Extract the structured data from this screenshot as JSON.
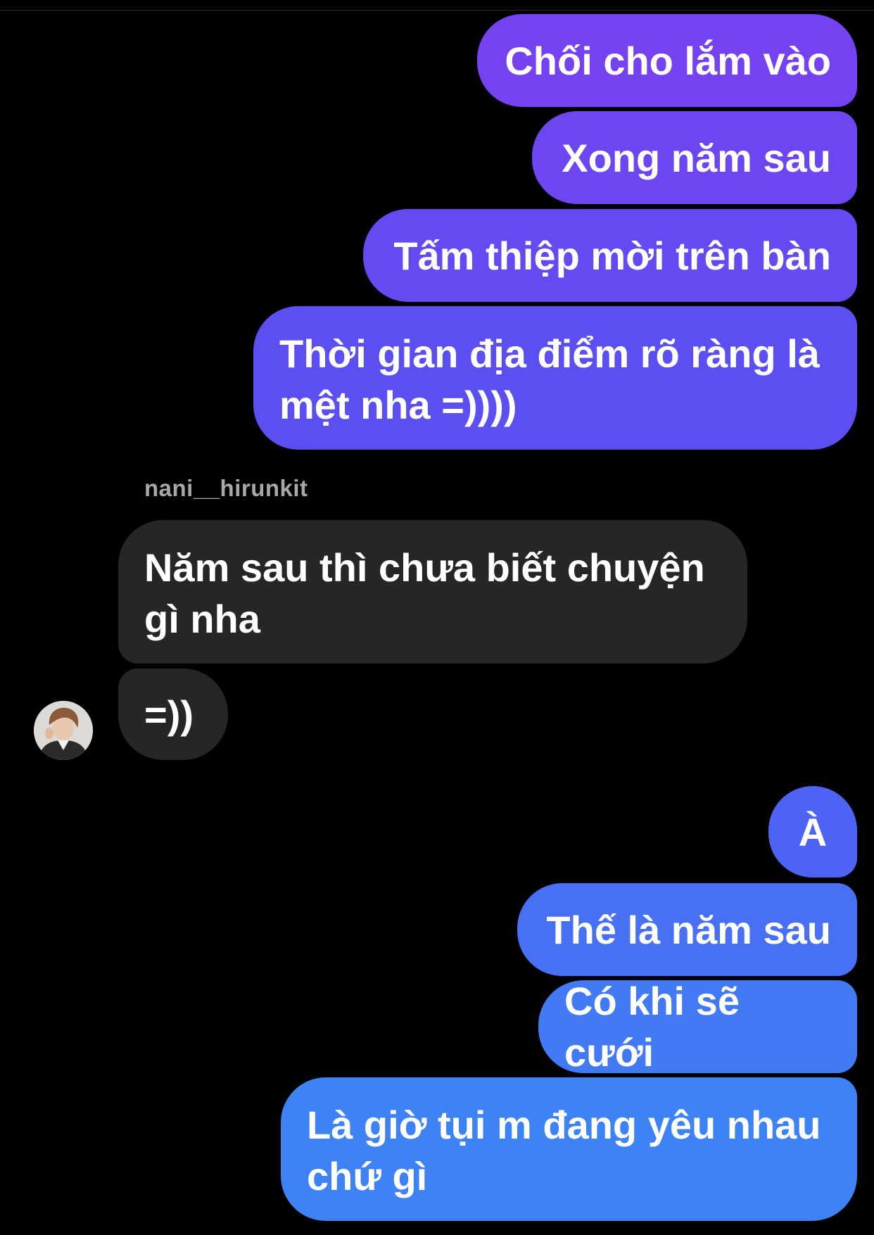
{
  "conversation": {
    "sent_group_1": [
      "Chối cho lắm vào",
      "Xong năm sau",
      "Tấm thiệp mời trên bàn",
      "Thời gian địa điểm rõ ràng là\nmệt nha =))))"
    ],
    "received": {
      "sender": "nani__hirunkit",
      "messages": [
        "Năm sau thì chưa biết chuyện\ngì nha",
        "=))"
      ],
      "avatar_icon": "profile-photo"
    },
    "sent_group_2": [
      "À",
      "Thế là năm sau",
      "Có khi sẽ cưới",
      "Là giờ tụi m đang yêu nhau\nchứ gì"
    ]
  },
  "colors": {
    "background": "#000000",
    "received_bubble": "#262626",
    "sent_gradient_top": "#7b3ff2",
    "sent_gradient_bottom": "#3a86f5",
    "sender_name": "#a8a8a8"
  }
}
